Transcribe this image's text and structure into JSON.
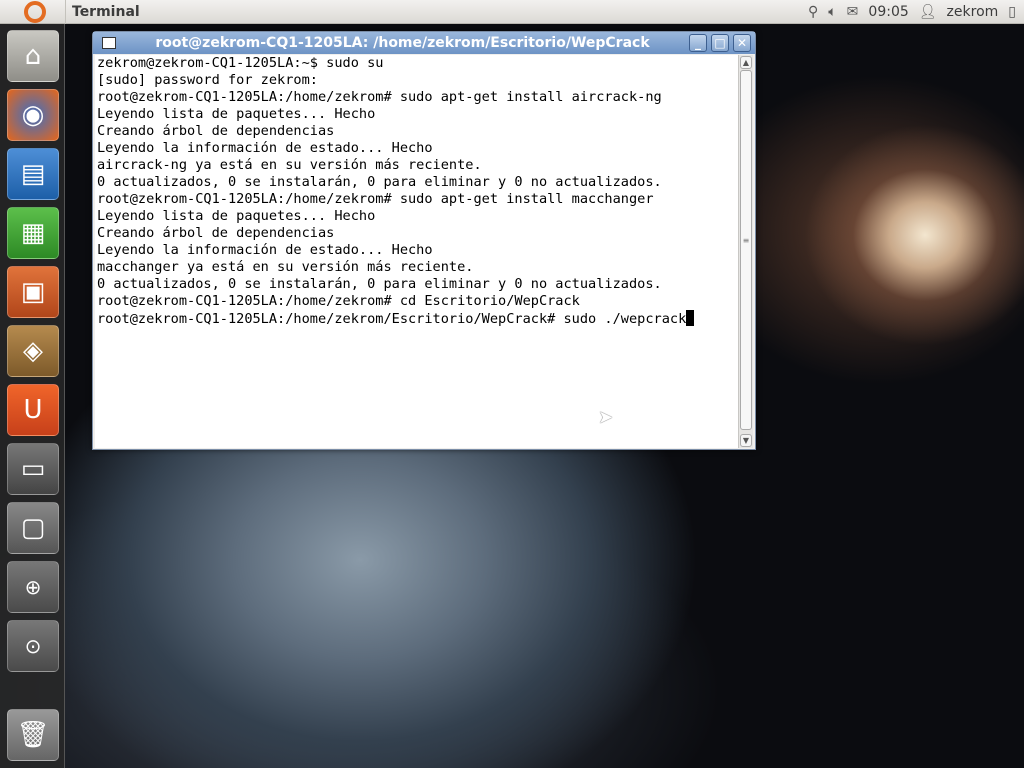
{
  "topbar": {
    "app_name": "Terminal",
    "time": "09:05",
    "user": "zekrom"
  },
  "launcher": {
    "items": [
      "home-folder",
      "firefox",
      "writer",
      "calc",
      "impress",
      "software-center",
      "ubuntu-one",
      "terminal",
      "workspaces",
      "zoom-in",
      "zoom-other",
      "trash"
    ]
  },
  "window": {
    "title": "root@zekrom-CQ1-1205LA: /home/zekrom/Escritorio/WepCrack",
    "lines": [
      "zekrom@zekrom-CQ1-1205LA:~$ sudo su",
      "[sudo] password for zekrom:",
      "root@zekrom-CQ1-1205LA:/home/zekrom# sudo apt-get install aircrack-ng",
      "Leyendo lista de paquetes... Hecho",
      "Creando árbol de dependencias",
      "Leyendo la información de estado... Hecho",
      "aircrack-ng ya está en su versión más reciente.",
      "0 actualizados, 0 se instalarán, 0 para eliminar y 0 no actualizados.",
      "root@zekrom-CQ1-1205LA:/home/zekrom# sudo apt-get install macchanger",
      "Leyendo lista de paquetes... Hecho",
      "Creando árbol de dependencias",
      "Leyendo la información de estado... Hecho",
      "macchanger ya está en su versión más reciente.",
      "0 actualizados, 0 se instalarán, 0 para eliminar y 0 no actualizados.",
      "root@zekrom-CQ1-1205LA:/home/zekrom# cd Escritorio/WepCrack",
      "root@zekrom-CQ1-1205LA:/home/zekrom/Escritorio/WepCrack# sudo ./wepcrack"
    ]
  }
}
